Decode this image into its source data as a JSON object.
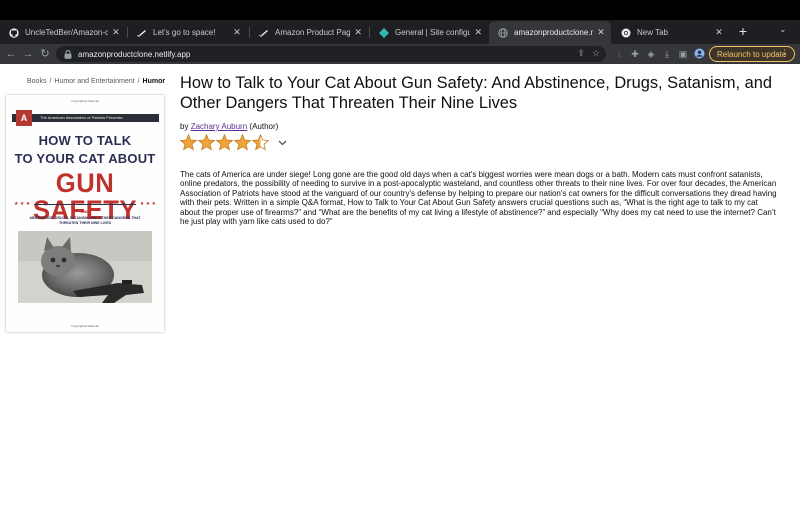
{
  "browser": {
    "tabs": [
      {
        "title": "UncleTedBer/Amazon-clone",
        "favicon": "github-icon"
      },
      {
        "title": "Let's go to space!",
        "favicon": "rocket-icon"
      },
      {
        "title": "Amazon Product Page Hint",
        "favicon": "rocket-icon"
      },
      {
        "title": "General | Site configuration |",
        "favicon": "netlify-icon"
      },
      {
        "title": "amazonproductclone.netlify.",
        "favicon": "globe-icon",
        "active": true
      },
      {
        "title": "New Tab",
        "favicon": "chrome-icon"
      }
    ],
    "url": "amazonproductclone.netlify.app",
    "relaunch_label": "Relaunch to update"
  },
  "page": {
    "breadcrumb": [
      "Books",
      "Humor and Entertainment",
      "Humor"
    ],
    "title": "How to Talk to Your Cat About Gun Safety: And Abstinence, Drugs, Satanism, and Other Dangers That Threaten Their Nine Lives",
    "byline_prefix": "by",
    "author": "Zachary Auburn",
    "author_role": "(Author)",
    "rating": 4.5,
    "rating_max": 5,
    "star_color": "#f0a43c",
    "description": "The cats of America are under siege! Long gone are the good old days when a cat's biggest worries were mean dogs or a bath. Modern cats must confront satanists, online predators, the possibility of needing to survive in a post-apocalyptic wasteland, and countless other threats to their nine lives. For over four decades, the American Association of Patriots have stood at the vanguard of our country's defense by helping to prepare our nation's cat owners for the difficult conversations they dread having with their pets. Written in a simple Q&A format, How to Talk to Your Cat About Gun Safety answers crucial questions such as, “What is the right age to talk to my cat about the proper use of firearms?” and “What are the benefits of my cat living a lifestyle of abstinence?” and especially “Why does my cat need to use the internet? Can’t he just play with yarn like cats used to do?”"
  },
  "cover": {
    "copyright_top": "Copyrighted Material",
    "logo_letter": "A",
    "band_text": "The American Association of Patriots Presents:",
    "line1": "HOW TO TALK",
    "line2": "TO YOUR CAT ABOUT",
    "line3": "GUN SAFETY",
    "and_word": "AND",
    "subtitle": "ABSTINENCE, DRUGS, SATANISM, AND OTHER DANGERS THAT THREATEN THEIR NINE LIVES",
    "copyright_bottom": "Copyrighted Material"
  }
}
